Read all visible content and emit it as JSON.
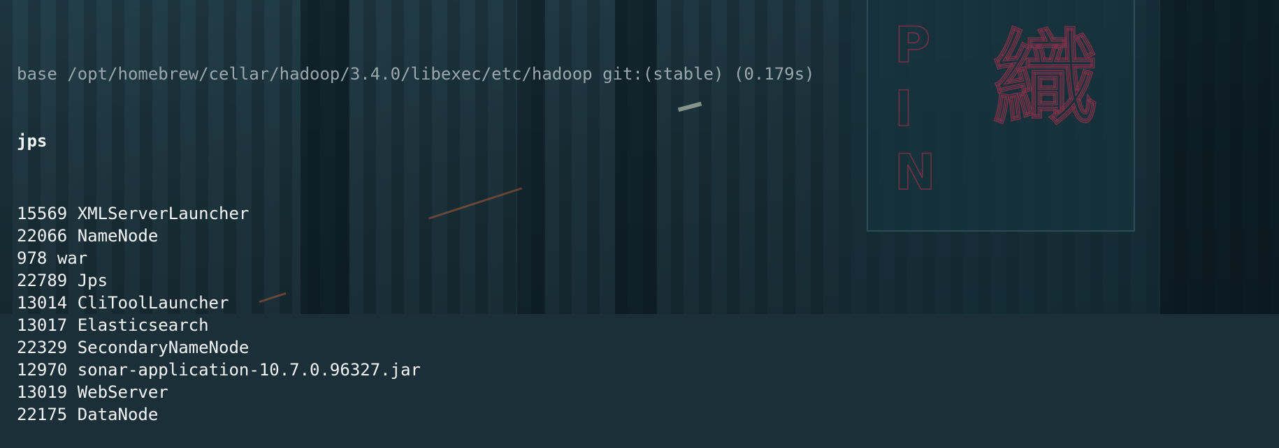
{
  "prompt": {
    "env": "base",
    "path": "/opt/homebrew/cellar/hadoop/3.4.0/libexec/etc/hadoop",
    "git": "git:(stable)",
    "duration": "(0.179s)"
  },
  "command": "jps",
  "output": [
    {
      "pid": "15569",
      "name": "XMLServerLauncher"
    },
    {
      "pid": "22066",
      "name": "NameNode"
    },
    {
      "pid": "978",
      "name": "war"
    },
    {
      "pid": "22789",
      "name": "Jps"
    },
    {
      "pid": "13014",
      "name": "CliToolLauncher"
    },
    {
      "pid": "13017",
      "name": "Elasticsearch"
    },
    {
      "pid": "22329",
      "name": "SecondaryNameNode"
    },
    {
      "pid": "12970",
      "name": "sonar-application-10.7.0.96327.jar"
    },
    {
      "pid": "13019",
      "name": "WebServer"
    },
    {
      "pid": "22175",
      "name": "DataNode"
    }
  ]
}
